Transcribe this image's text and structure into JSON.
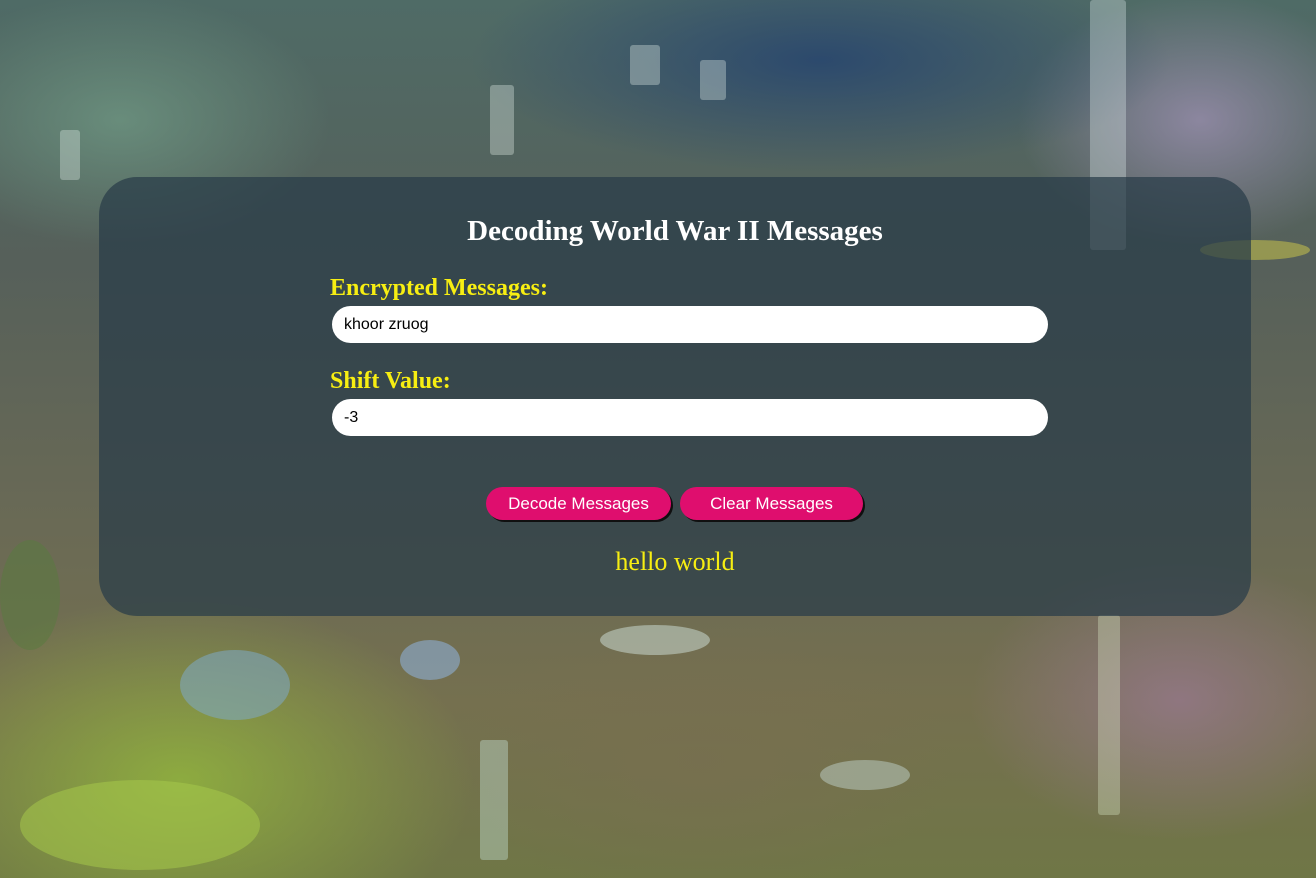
{
  "page": {
    "title": "Decoding World War II Messages"
  },
  "form": {
    "encrypted_label": "Encrypted Messages:",
    "encrypted_value": "khoor zruog",
    "shift_label": "Shift Value:",
    "shift_value": "-3"
  },
  "actions": {
    "decode_label": "Decode Messages",
    "clear_label": "Clear Messages"
  },
  "output": {
    "decoded_text": "hello world"
  },
  "colors": {
    "label_accent": "#f7ee12",
    "button_bg": "#df0e6e",
    "panel_bg": "rgba(40, 60, 72, 0.72)"
  }
}
